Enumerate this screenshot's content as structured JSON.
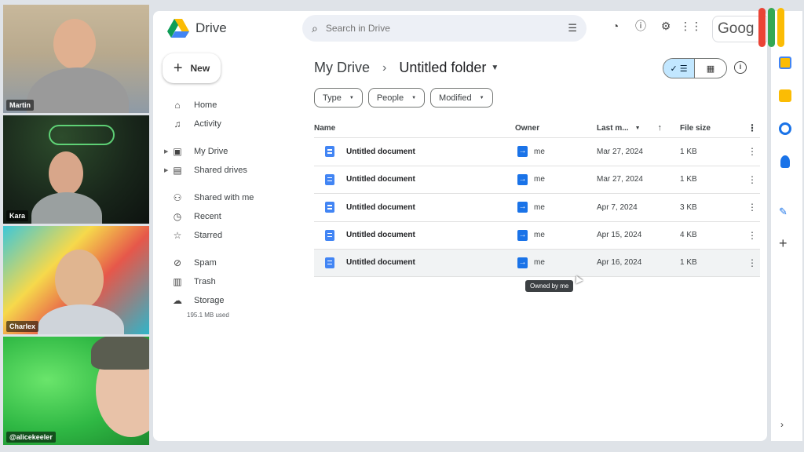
{
  "participants": [
    {
      "name": "Martin"
    },
    {
      "name": "Kara"
    },
    {
      "name": "Charlex"
    },
    {
      "name": "@alicekeeler"
    }
  ],
  "header": {
    "app_name": "Drive",
    "search_placeholder": "Search in Drive",
    "account_label": "Goog"
  },
  "sidebar": {
    "new_label": "New",
    "items": [
      {
        "label": "Home",
        "icon": "home-icon"
      },
      {
        "label": "Activity",
        "icon": "bell-icon"
      },
      {
        "label": "My Drive",
        "icon": "drive-icon"
      },
      {
        "label": "Shared drives",
        "icon": "shared-drives-icon"
      },
      {
        "label": "Shared with me",
        "icon": "people-icon"
      },
      {
        "label": "Recent",
        "icon": "clock-icon"
      },
      {
        "label": "Starred",
        "icon": "star-icon"
      },
      {
        "label": "Spam",
        "icon": "spam-icon"
      },
      {
        "label": "Trash",
        "icon": "trash-icon"
      },
      {
        "label": "Storage",
        "icon": "cloud-icon"
      }
    ],
    "storage_used": "195.1 MB used"
  },
  "breadcrumb": {
    "root": "My Drive",
    "current": "Untitled folder"
  },
  "filters": [
    "Type",
    "People",
    "Modified"
  ],
  "table": {
    "headers": {
      "name": "Name",
      "owner": "Owner",
      "modified": "Last m...",
      "size": "File size"
    },
    "rows": [
      {
        "name": "Untitled document",
        "owner": "me",
        "modified": "Mar 27, 2024",
        "size": "1 KB"
      },
      {
        "name": "Untitled document",
        "owner": "me",
        "modified": "Mar 27, 2024",
        "size": "1 KB"
      },
      {
        "name": "Untitled document",
        "owner": "me",
        "modified": "Apr 7, 2024",
        "size": "3 KB"
      },
      {
        "name": "Untitled document",
        "owner": "me",
        "modified": "Apr 15, 2024",
        "size": "4 KB"
      },
      {
        "name": "Untitled document",
        "owner": "me",
        "modified": "Apr 16, 2024",
        "size": "1 KB"
      }
    ]
  },
  "tooltip": "Owned by me",
  "colors": {
    "accent": "#1a73e8",
    "doc_blue": "#4285f4",
    "toggle_active": "#c2e7ff"
  }
}
